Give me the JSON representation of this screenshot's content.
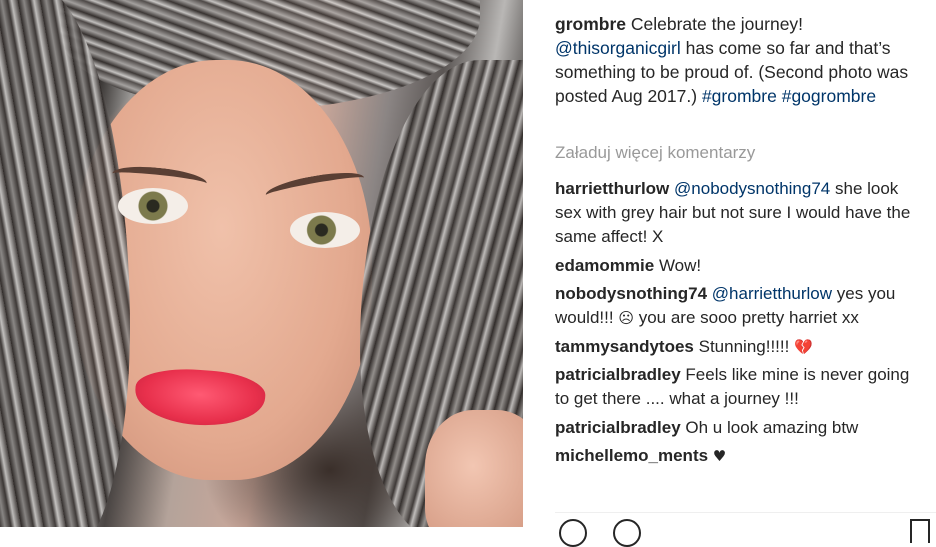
{
  "caption": {
    "username": "grombre",
    "text_1": "Celebrate the journey!",
    "mention": "@thisorganicgirl",
    "text_2": "has come so far and that’s something to be proud of. (Second photo was posted Aug 2017.)",
    "hashtag_1": "#grombre",
    "hashtag_2": "#gogrombre"
  },
  "load_more": "Załaduj więcej komentarzy",
  "comments": [
    {
      "user": "harrietthurlow",
      "mention": "@nobodysnothing74",
      "text": "she look sex with grey hair but not sure I would have the same affect! X"
    },
    {
      "user": "edamommie",
      "mention": "",
      "text": "Wow!"
    },
    {
      "user": "nobodysnothing74",
      "mention": "@harrietthurlow",
      "text_before_emoji": "yes you would!!!",
      "emoji": "☹",
      "text_after_emoji": "you are sooo pretty harriet xx"
    },
    {
      "user": "tammysandytoes",
      "mention": "",
      "text": "Stunning!!!!!",
      "emoji": "💔"
    },
    {
      "user": "patricialbradley",
      "mention": "",
      "text": "Feels like mine is never going to get there .... what a journey !!!"
    },
    {
      "user": "patricialbradley",
      "mention": "",
      "text": "Oh u look amazing btw"
    },
    {
      "user": "michellemo_ments",
      "mention": "",
      "text": "",
      "emoji": "♥"
    }
  ],
  "icons": {
    "like": "heart-outline-icon",
    "comment": "speech-bubble-icon",
    "save": "bookmark-icon"
  },
  "colors": {
    "link": "#003569",
    "muted": "#999999",
    "text": "#262626",
    "lipstick": "#e8304c"
  }
}
